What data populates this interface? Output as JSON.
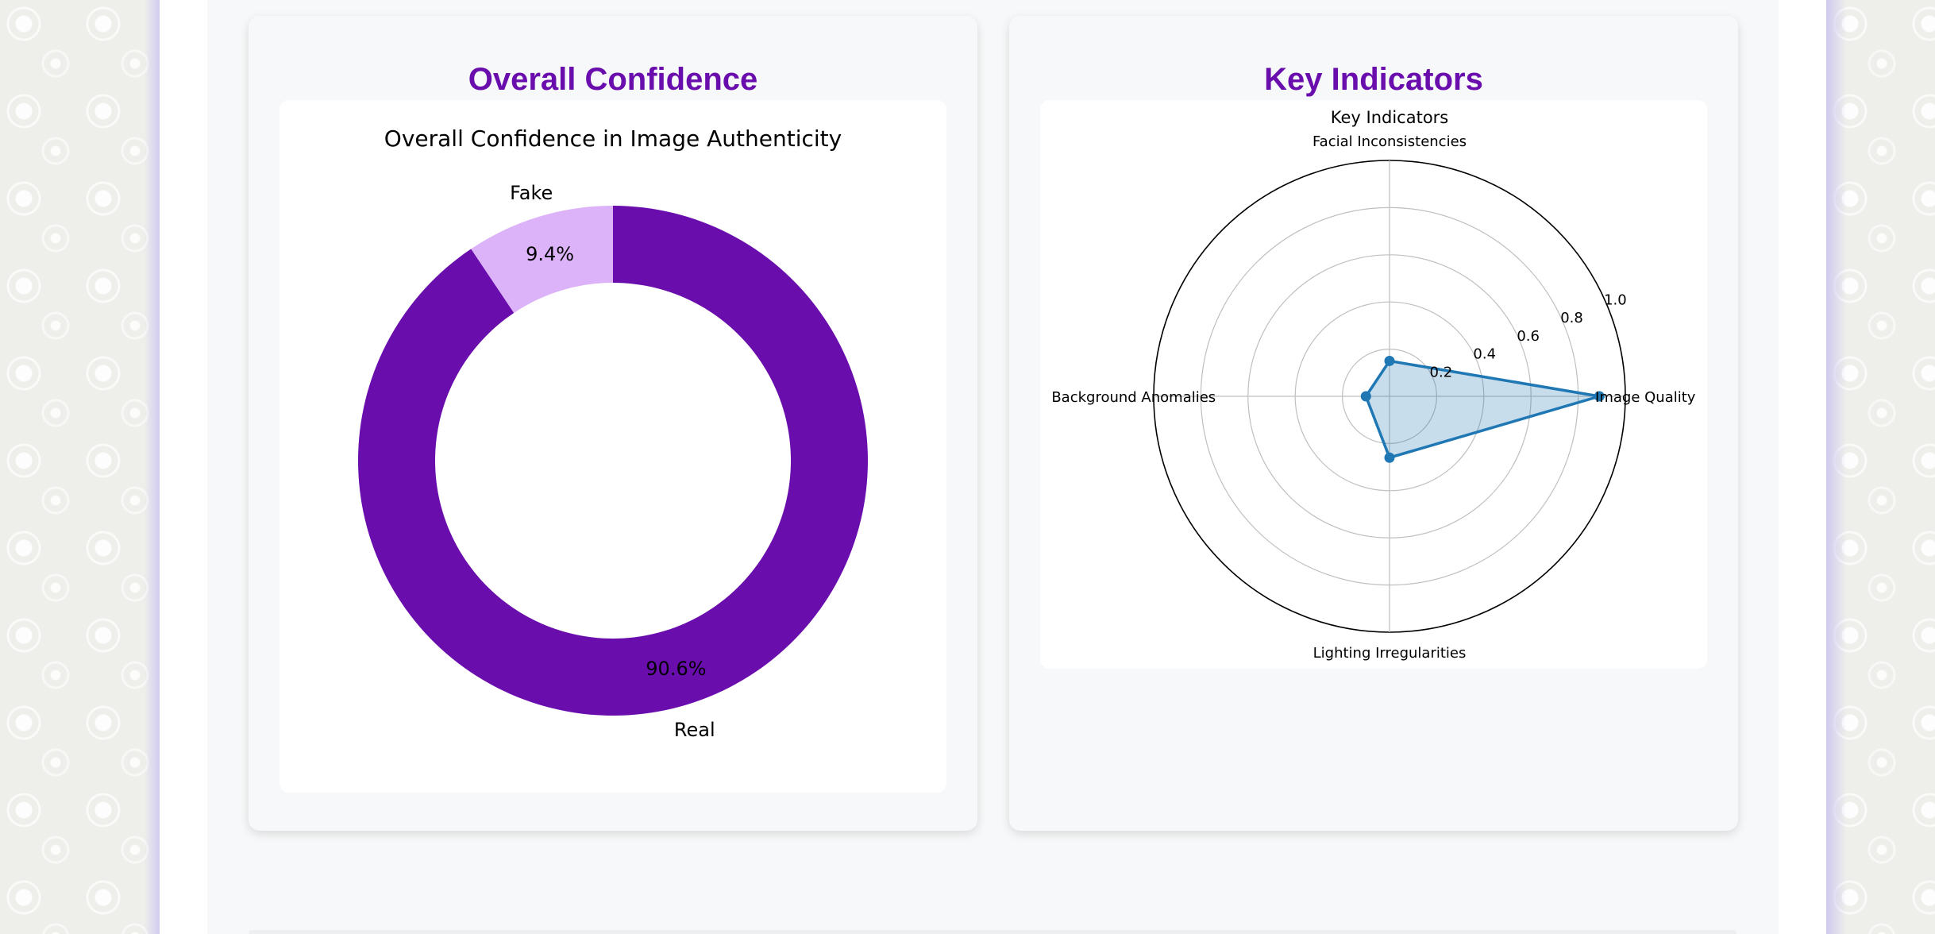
{
  "cards": {
    "confidence": {
      "heading": "Overall Confidence"
    },
    "indicators": {
      "heading": "Key Indicators"
    }
  },
  "colors": {
    "accent": "#6a0dad",
    "real_slice": "#6a0dad",
    "fake_slice": "#dcb3f8",
    "radar_line": "#1f77b4"
  },
  "chart_data": [
    {
      "type": "pie",
      "style": "donut",
      "title": "Overall Confidence in Image Authenticity",
      "categories": [
        "Real",
        "Fake"
      ],
      "values": [
        90.6,
        9.4
      ],
      "value_labels": [
        "90.6%",
        "9.4%"
      ],
      "colors": [
        "#6a0dad",
        "#dcb3f8"
      ]
    },
    {
      "type": "radar",
      "title": "Key Indicators",
      "categories": [
        "Image Quality",
        "Facial Inconsistencies",
        "Background Anomalies",
        "Lighting Irregularities"
      ],
      "values": [
        0.89,
        0.15,
        0.1,
        0.26
      ],
      "rlim": [
        0,
        1.0
      ],
      "rticks": [
        0.2,
        0.4,
        0.6,
        0.8,
        1.0
      ],
      "rtick_labels": [
        "0.2",
        "0.4",
        "0.6",
        "0.8",
        "1.0"
      ],
      "grid": true
    }
  ]
}
